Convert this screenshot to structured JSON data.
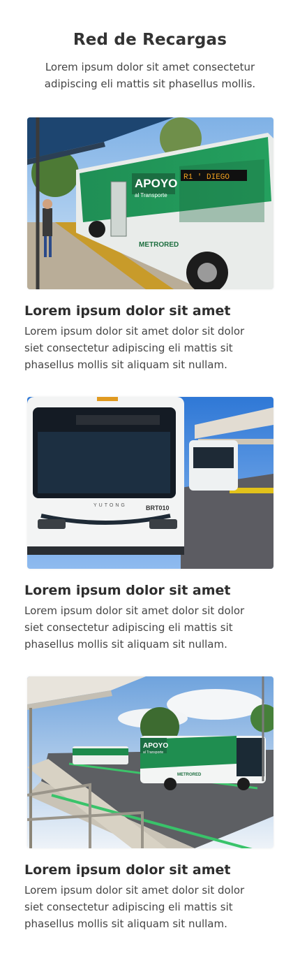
{
  "header": {
    "title": "Red de Recargas",
    "subtitle": "Lorem ipsum dolor sit amet consectetur adipiscing eli mattis sit phasellus mollis."
  },
  "cards": [
    {
      "title": "Lorem ipsum dolor sit amet",
      "text": "Lorem ipsum dolor sit amet dolor sit dolor siet consectetur adipiscing eli mattis sit phasellus mollis sit aliquam sit nullam.",
      "image_alt": "Green Metrored bus at a covered stop",
      "bus_panel": "APOYO",
      "bus_panel_sub": "al Transporte",
      "bus_route": "R1 ' DIEGO",
      "bus_brand": "METRORED"
    },
    {
      "title": "Lorem ipsum dolor sit amet",
      "text": "Lorem ipsum dolor sit amet dolor sit dolor siet consectetur adipiscing eli mattis sit phasellus mollis sit aliquam sit nullam.",
      "image_alt": "Front view of white BRT bus at station",
      "bus_maker": "YUTONG",
      "bus_number": "BRT010"
    },
    {
      "title": "Lorem ipsum dolor sit amet",
      "text": "Lorem ipsum dolor sit amet dolor sit dolor siet consectetur adipiscing eli mattis sit phasellus mollis sit aliquam sit nullam.",
      "image_alt": "Row of green and white buses along dedicated lane",
      "bus_panel": "APOYO",
      "bus_panel_sub": "al Transporte",
      "bus_brand": "METRORED"
    }
  ],
  "colors": {
    "bus_green": "#1e8a4c",
    "sky": "#8fbde8",
    "accent_yellow": "#e0b21a"
  }
}
